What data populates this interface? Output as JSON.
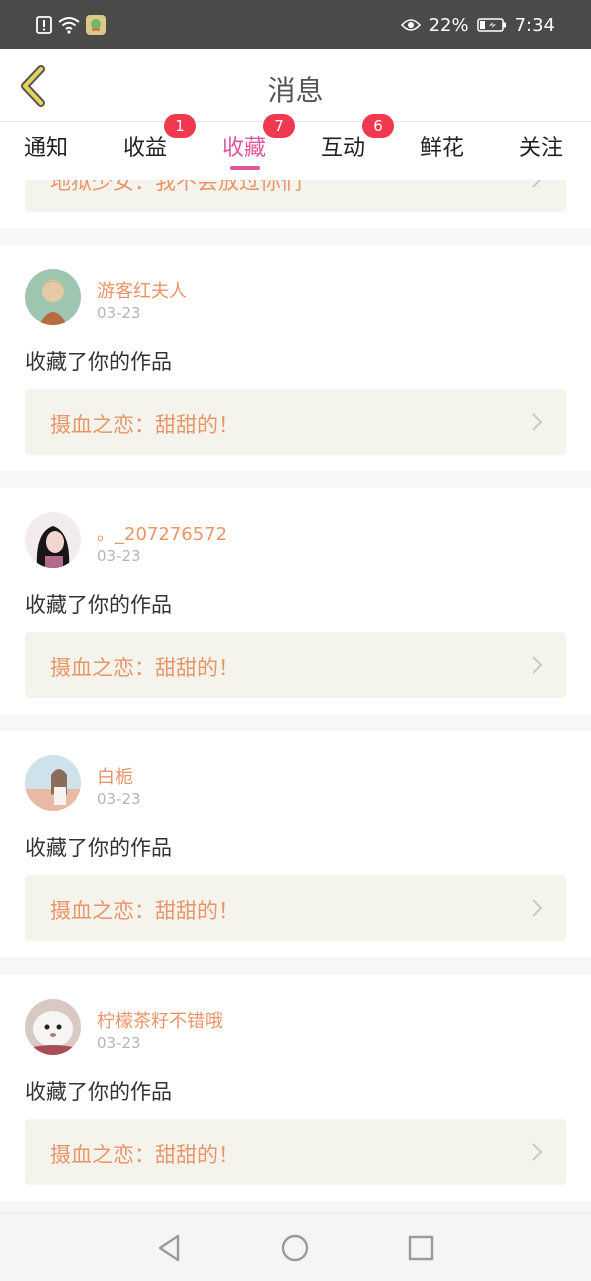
{
  "status_bar": {
    "icons": [
      "alert-icon",
      "wifi-icon",
      "app-notification-icon",
      "eye-icon",
      "battery-icon"
    ],
    "battery": "22%",
    "time": "7:34"
  },
  "header": {
    "title": "消息",
    "back_icon": "back-chevron-icon"
  },
  "tabs": [
    {
      "label": "通知",
      "badge": ""
    },
    {
      "label": "收益",
      "badge": "1"
    },
    {
      "label": "收藏",
      "badge": "7",
      "active": true
    },
    {
      "label": "互动",
      "badge": "6"
    },
    {
      "label": "鲜花",
      "badge": ""
    },
    {
      "label": "关注",
      "badge": ""
    }
  ],
  "partial_item": {
    "work_title": "地狱少女：我不会放过你们"
  },
  "items": [
    {
      "username": "游客红夫人",
      "date": "03-23",
      "action": "收藏了你的作品",
      "work_title": "摄血之恋：甜甜的！"
    },
    {
      "username": "。_207276572",
      "date": "03-23",
      "action": "收藏了你的作品",
      "work_title": "摄血之恋：甜甜的！"
    },
    {
      "username": "白栀",
      "date": "03-23",
      "action": "收藏了你的作品",
      "work_title": "摄血之恋：甜甜的！"
    },
    {
      "username": "柠檬茶籽不错哦",
      "date": "03-23",
      "action": "收藏了你的作品",
      "work_title": "摄血之恋：甜甜的！"
    }
  ],
  "colors": {
    "accent": "#e0589a",
    "badge": "#f0394e",
    "username": "#e8956a",
    "link_bg": "#f5f4ec"
  },
  "nav": [
    "back-triangle-icon",
    "home-circle-icon",
    "recents-square-icon"
  ]
}
